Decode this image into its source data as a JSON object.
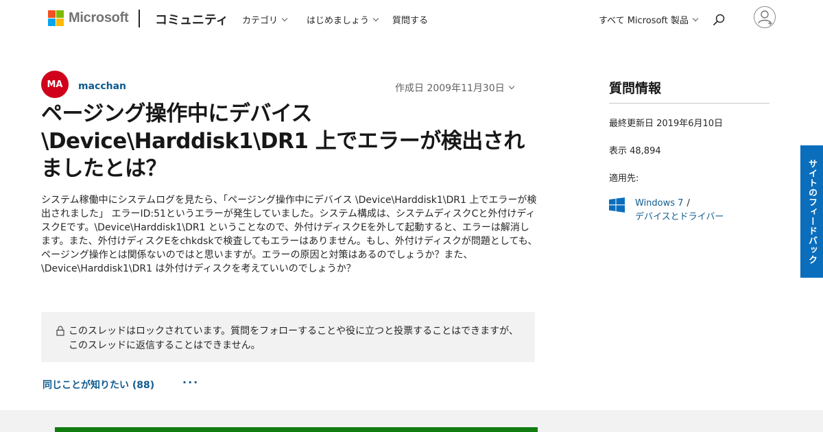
{
  "header": {
    "brand": "Microsoft",
    "brand_colors": [
      "#f25022",
      "#7fba00",
      "#00a4ef",
      "#ffb900"
    ],
    "community": "コミュニティ",
    "nav": [
      "カテゴリ",
      "はじめましょう",
      "質問する"
    ],
    "products": "すべて Microsoft 製品",
    "icons": {
      "search": "search-icon",
      "account": "account-icon"
    }
  },
  "post": {
    "author_initials": "MA",
    "author_name": "macchan",
    "created": "作成日 2009年11月30日",
    "title": "ページング操作中にデバイス \\Device\\Harddisk1\\DR1 上でエラーが検出されましたとは？",
    "body": "システム稼働中にシステムログを見たら、「ページング操作中にデバイス \\Device\\Harddisk1\\DR1 上でエラーが検出されました」 エラーID:51というエラーが発生していました。システム構成は、システムディスクCと外付けディスクEです。\\Device\\Harddisk1\\DR1 ということなので、外付けディスクEを外して起動すると、エラーは解消します。また、外付けディスクEをchkdskで検査してもエラーはありません。もし、外付けディスクが問題としても、ページング操作とは関係ないのではと思いますが。エラーの原因と対策はあるのでしょうか？また、 \\Device\\Harddisk1\\DR1 は外付けディスクを考えていいのでしょうか？",
    "locked_notice": "このスレッドはロックされています。質問をフォローすることや役に立つと投票することはできますが、このスレッドに返信することはできません。",
    "same_question": "同じことが知りたい (88)",
    "more": "···"
  },
  "sidebar": {
    "title": "質問情報",
    "updated": "最終更新日 2019年6月10日",
    "views": "表示 48,894",
    "applies_label": "適用先:",
    "applies": [
      "Windows 7",
      "デバイスとドライバー"
    ],
    "separator": "/"
  },
  "feedback": "サイトのフィードバック",
  "colors": {
    "link": "#0f5b8f",
    "avatar": "#d0021b",
    "feedback": "#0a6ebd",
    "accent_bar": "#107c10"
  }
}
